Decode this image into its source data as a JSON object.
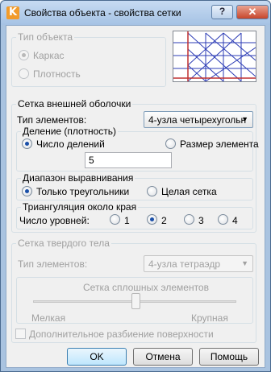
{
  "window": {
    "title": "Свойства объекта - свойства сетки",
    "app_icon_letter": "K",
    "help_label": "?",
    "close_label": "✕"
  },
  "object_type": {
    "title": "Тип объекта",
    "options": [
      "Каркас",
      "Плотность"
    ],
    "selected": "Каркас",
    "disabled": true
  },
  "shell_mesh": {
    "title": "Сетка внешней оболочки",
    "element_type_label": "Тип элементов:",
    "element_type_value": "4-узла четырехугольн",
    "division": {
      "title": "Деление (плотность)",
      "options": [
        "Число делений",
        "Размер элемента"
      ],
      "selected": "Число делений",
      "value": "5"
    },
    "alignment": {
      "title": "Диапазон выравнивания",
      "options": [
        "Только треугольники",
        "Целая сетка"
      ],
      "selected": "Только треугольники"
    },
    "edge_triangulation": {
      "title": "Триангуляция около края",
      "levels_label": "Число уровней:",
      "options": [
        "1",
        "2",
        "3",
        "4"
      ],
      "selected": "2"
    }
  },
  "solid_mesh": {
    "title": "Сетка твердого тела",
    "element_type_label": "Тип элементов:",
    "element_type_value": "4-узла тетраэдр",
    "slider": {
      "title": "Сетка сплошных элементов",
      "min_label": "Мелкая",
      "max_label": "Крупная",
      "value": 0.5
    },
    "extra_label": "Дополнительное разбиение поверхности",
    "extra_checked": false,
    "disabled": true
  },
  "buttons": {
    "ok": "OK",
    "cancel": "Отмена",
    "help": "Помощь"
  },
  "colors": {
    "title_bar": "#b8d0ec",
    "mesh_lines": "#2b3bb5",
    "axis_lines": "#c03030",
    "close_button": "#c7452b"
  }
}
